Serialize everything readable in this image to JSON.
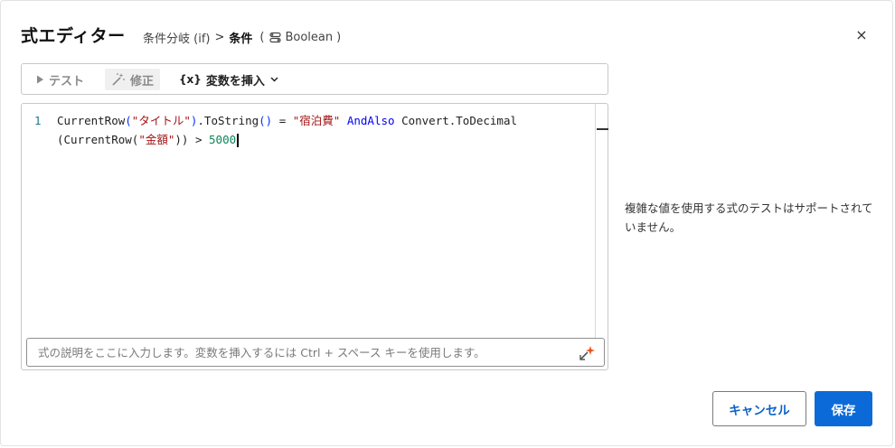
{
  "dialog": {
    "title": "式エディター",
    "breadcrumb": {
      "step": "条件分岐 (if)",
      "separator": ">",
      "current": "条件",
      "paren_open": "(",
      "type": "Boolean",
      "paren_close": ")"
    },
    "close_icon": "×"
  },
  "toolbar": {
    "test_label": "テスト",
    "fix_label": "修正",
    "insert_var_icon": "{x}",
    "insert_var_label": "変数を挿入"
  },
  "editor": {
    "line_number": "1",
    "code": {
      "t1": "CurrentRow",
      "t2": "(",
      "t3": "\"タイトル\"",
      "t4": ")",
      "t5": ".ToString",
      "t6": "()",
      "t7": " = ",
      "t8": "\"宿泊費\"",
      "t9": " ",
      "t10": "AndAlso",
      "t11": " Convert.ToDecimal",
      "t12": "(CurrentRow(",
      "t13": "\"金額\"",
      "t14": "))",
      "t15": " > ",
      "t16": "5000"
    },
    "description_placeholder": "式の説明をここに入力します。変数を挿入するには Ctrl + スペース キーを使用します。",
    "description_value": ""
  },
  "side_note": "複雑な値を使用する式のテストはサポートされていません。",
  "footer": {
    "cancel_label": "キャンセル",
    "save_label": "保存"
  },
  "colors": {
    "primary": "#0b6ad7",
    "string": "#a31515",
    "keyword": "#0000ff",
    "number": "#098658"
  }
}
